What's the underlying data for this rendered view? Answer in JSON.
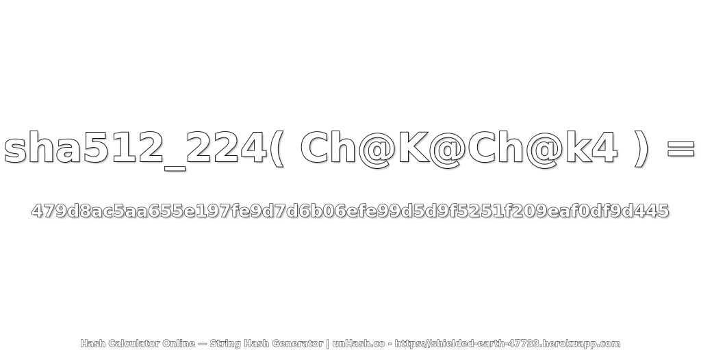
{
  "heading": "sha512_224( Ch@K@Ch@k4 ) =",
  "hash": "479d8ac5aa655e197fe9d7d6b06efe99d5d9f5251f209eaf0df9d445",
  "footer": "Hash Calculator Online — String Hash Generator | unHash.co - https://shielded-earth-47733.herokuapp.com"
}
